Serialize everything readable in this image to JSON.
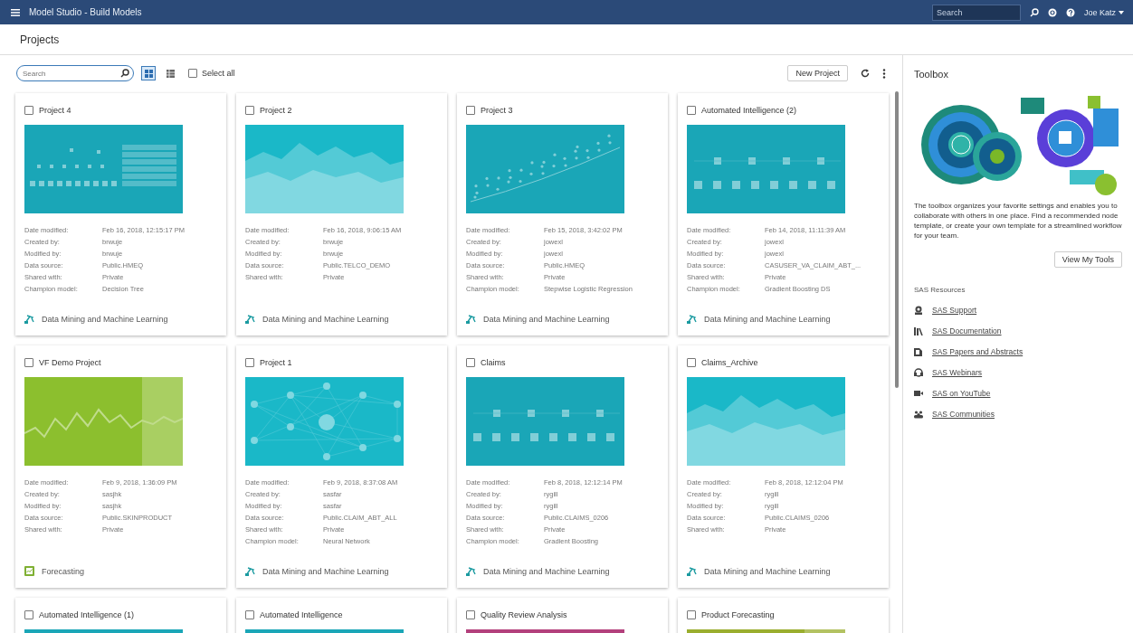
{
  "topbar": {
    "title": "Model Studio - Build Models",
    "search_placeholder": "Search",
    "user": "Joe Katz"
  },
  "page_title": "Projects",
  "toolbar": {
    "search_placeholder": "Search",
    "views": [
      {
        "kind": "tiles",
        "selected": true
      },
      {
        "kind": "table",
        "selected": false
      }
    ],
    "select_all": {
      "label": "Select all",
      "checked": false
    },
    "new_project": "New Project"
  },
  "projects": [
    {
      "title": "Project 4",
      "checked": false,
      "thumbnail": {
        "kind": "blocks",
        "color": "#1aa6b7"
      },
      "details": [
        {
          "label": "Date modified:",
          "value": "Feb 16, 2018, 12:15:17 PM"
        },
        {
          "label": "Created by:",
          "value": "brwuje"
        },
        {
          "label": "Modified by:",
          "value": "brwuje"
        },
        {
          "label": "Data source:",
          "value": "Public.HMEQ"
        },
        {
          "label": "Shared with:",
          "value": "Private"
        },
        {
          "label": "Champion model:",
          "value": "Decision Tree"
        }
      ],
      "type": {
        "kind": "data-mining",
        "label": "Data Mining and Machine Learning"
      }
    },
    {
      "title": "Project 2",
      "checked": false,
      "thumbnail": {
        "kind": "area",
        "color": "#1ab8c8"
      },
      "details": [
        {
          "label": "Date modified:",
          "value": "Feb 16, 2018, 9:06:15 AM"
        },
        {
          "label": "Created by:",
          "value": "brwuje"
        },
        {
          "label": "Modified by:",
          "value": "brwuje"
        },
        {
          "label": "Data source:",
          "value": "Public.TELCO_DEMO"
        },
        {
          "label": "Shared with:",
          "value": "Private"
        }
      ],
      "type": {
        "kind": "data-mining",
        "label": "Data Mining and Machine Learning"
      }
    },
    {
      "title": "Project 3",
      "checked": false,
      "thumbnail": {
        "kind": "scatter",
        "color": "#1aa6b7"
      },
      "details": [
        {
          "label": "Date modified:",
          "value": "Feb 15, 2018, 3:42:02 PM"
        },
        {
          "label": "Created by:",
          "value": "jowexl"
        },
        {
          "label": "Modified by:",
          "value": "jowexl"
        },
        {
          "label": "Data source:",
          "value": "Public.HMEQ"
        },
        {
          "label": "Shared with:",
          "value": "Private"
        },
        {
          "label": "Champion model:",
          "value": "Stepwise Logistic Regression"
        }
      ],
      "type": {
        "kind": "data-mining",
        "label": "Data Mining and Machine Learning"
      }
    },
    {
      "title": "Automated Intelligence (2)",
      "checked": false,
      "thumbnail": {
        "kind": "flow",
        "color": "#1aa6b7"
      },
      "details": [
        {
          "label": "Date modified:",
          "value": "Feb 14, 2018, 11:11:39 AM"
        },
        {
          "label": "Created by:",
          "value": "jowexl"
        },
        {
          "label": "Modified by:",
          "value": "jowexl"
        },
        {
          "label": "Data source:",
          "value": "CASUSER_VA_CLAIM_ABT_..."
        },
        {
          "label": "Shared with:",
          "value": "Private"
        },
        {
          "label": "Champion model:",
          "value": "Gradient Boosting DS"
        }
      ],
      "type": {
        "kind": "data-mining",
        "label": "Data Mining and Machine Learning"
      }
    },
    {
      "title": "VF Demo Project",
      "checked": false,
      "thumbnail": {
        "kind": "line",
        "color": "#8cbf2e"
      },
      "details": [
        {
          "label": "Date modified:",
          "value": "Feb 9, 2018, 1:36:09 PM"
        },
        {
          "label": "Created by:",
          "value": "sasjhk"
        },
        {
          "label": "Modified by:",
          "value": "sasjhk"
        },
        {
          "label": "Data source:",
          "value": "Public.SKINPRODUCT"
        },
        {
          "label": "Shared with:",
          "value": "Private"
        }
      ],
      "type": {
        "kind": "forecasting",
        "label": "Forecasting"
      }
    },
    {
      "title": "Project 1",
      "checked": false,
      "thumbnail": {
        "kind": "network",
        "color": "#1ab8c8"
      },
      "details": [
        {
          "label": "Date modified:",
          "value": "Feb 9, 2018, 8:37:08 AM"
        },
        {
          "label": "Created by:",
          "value": "sasfar"
        },
        {
          "label": "Modified by:",
          "value": "sasfar"
        },
        {
          "label": "Data source:",
          "value": "Public.CLAIM_ABT_ALL"
        },
        {
          "label": "Shared with:",
          "value": "Private"
        },
        {
          "label": "Champion model:",
          "value": "Neural Network"
        }
      ],
      "type": {
        "kind": "data-mining",
        "label": "Data Mining and Machine Learning"
      }
    },
    {
      "title": "Claims",
      "checked": false,
      "thumbnail": {
        "kind": "flow",
        "color": "#1aa6b7"
      },
      "details": [
        {
          "label": "Date modified:",
          "value": "Feb 8, 2018, 12:12:14 PM"
        },
        {
          "label": "Created by:",
          "value": "rygill"
        },
        {
          "label": "Modified by:",
          "value": "rygill"
        },
        {
          "label": "Data source:",
          "value": "Public.CLAIMS_0206"
        },
        {
          "label": "Shared with:",
          "value": "Private"
        },
        {
          "label": "Champion model:",
          "value": "Gradient Boosting"
        }
      ],
      "type": {
        "kind": "data-mining",
        "label": "Data Mining and Machine Learning"
      }
    },
    {
      "title": "Claims_Archive",
      "checked": false,
      "thumbnail": {
        "kind": "area",
        "color": "#1ab8c8"
      },
      "details": [
        {
          "label": "Date modified:",
          "value": "Feb 8, 2018, 12:12:04 PM"
        },
        {
          "label": "Created by:",
          "value": "rygill"
        },
        {
          "label": "Modified by:",
          "value": "rygill"
        },
        {
          "label": "Data source:",
          "value": "Public.CLAIMS_0206"
        },
        {
          "label": "Shared with:",
          "value": "Private"
        }
      ],
      "type": {
        "kind": "data-mining",
        "label": "Data Mining and Machine Learning"
      }
    },
    {
      "title": "Automated Intelligence (1)",
      "checked": false,
      "thumbnail": {
        "kind": "flow",
        "color": "#1aa6b7"
      }
    },
    {
      "title": "Automated Intelligence",
      "checked": false,
      "thumbnail": {
        "kind": "flow",
        "color": "#1aa6b7"
      }
    },
    {
      "title": "Quality Review Analysis",
      "checked": false,
      "thumbnail": {
        "kind": "flow",
        "color": "#b3407c"
      }
    },
    {
      "title": "Product Forecasting",
      "checked": false,
      "thumbnail": {
        "kind": "line",
        "color": "#9aae2e"
      }
    }
  ],
  "toolbox": {
    "title": "Toolbox",
    "description": "The toolbox organizes your favorite settings and enables you to collaborate with others in one place. Find a recommended node template, or create your own template for a streamlined workflow for your team.",
    "button": "View My Tools",
    "resources_title": "SAS Resources",
    "resources": [
      {
        "kind": "support",
        "label": "SAS Support"
      },
      {
        "kind": "documentation",
        "label": "SAS Documentation"
      },
      {
        "kind": "papers",
        "label": "SAS Papers and Abstracts"
      },
      {
        "kind": "webinars",
        "label": "SAS Webinars"
      },
      {
        "kind": "youtube",
        "label": "SAS on YouTube"
      },
      {
        "kind": "communities",
        "label": "SAS Communities"
      }
    ]
  }
}
